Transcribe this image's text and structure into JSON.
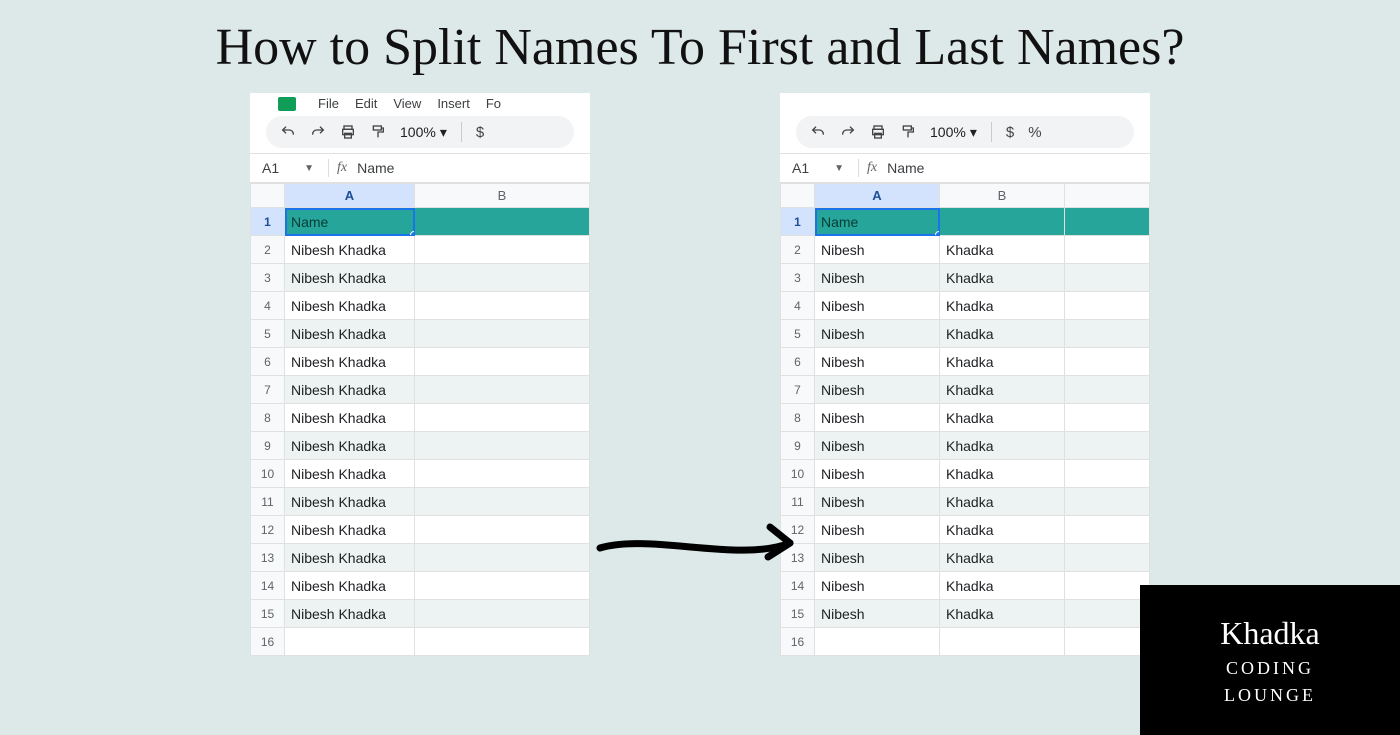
{
  "title": "How to Split Names To First and Last Names?",
  "toolbar": {
    "zoom": "100%",
    "currency": "$",
    "percent": "%"
  },
  "menubar": [
    "File",
    "Edit",
    "View",
    "Insert",
    "Fo"
  ],
  "formula_bar": {
    "cell_ref": "A1",
    "fx_label": "fx",
    "value": "Name"
  },
  "columns": [
    "A",
    "B"
  ],
  "left_sheet": {
    "header_row": {
      "A": "Name",
      "B": ""
    },
    "rows": [
      {
        "n": 2,
        "A": "Nibesh  Khadka",
        "B": ""
      },
      {
        "n": 3,
        "A": "Nibesh Khadka",
        "B": ""
      },
      {
        "n": 4,
        "A": "Nibesh Khadka",
        "B": ""
      },
      {
        "n": 5,
        "A": "Nibesh Khadka",
        "B": ""
      },
      {
        "n": 6,
        "A": "Nibesh Khadka",
        "B": ""
      },
      {
        "n": 7,
        "A": "Nibesh Khadka",
        "B": ""
      },
      {
        "n": 8,
        "A": "Nibesh Khadka",
        "B": ""
      },
      {
        "n": 9,
        "A": "Nibesh Khadka",
        "B": ""
      },
      {
        "n": 10,
        "A": "Nibesh Khadka",
        "B": ""
      },
      {
        "n": 11,
        "A": "Nibesh Khadka",
        "B": ""
      },
      {
        "n": 12,
        "A": "Nibesh Khadka",
        "B": ""
      },
      {
        "n": 13,
        "A": "Nibesh Khadka",
        "B": ""
      },
      {
        "n": 14,
        "A": "Nibesh Khadka",
        "B": ""
      },
      {
        "n": 15,
        "A": "Nibesh Khadka",
        "B": ""
      },
      {
        "n": 16,
        "A": "",
        "B": ""
      }
    ]
  },
  "right_sheet": {
    "header_row": {
      "A": "Name",
      "B": ""
    },
    "rows": [
      {
        "n": 2,
        "A": "Nibesh",
        "B": "Khadka"
      },
      {
        "n": 3,
        "A": "Nibesh",
        "B": "Khadka"
      },
      {
        "n": 4,
        "A": "Nibesh",
        "B": "Khadka"
      },
      {
        "n": 5,
        "A": "Nibesh",
        "B": "Khadka"
      },
      {
        "n": 6,
        "A": "Nibesh",
        "B": "Khadka"
      },
      {
        "n": 7,
        "A": "Nibesh",
        "B": "Khadka"
      },
      {
        "n": 8,
        "A": "Nibesh",
        "B": "Khadka"
      },
      {
        "n": 9,
        "A": "Nibesh",
        "B": "Khadka"
      },
      {
        "n": 10,
        "A": "Nibesh",
        "B": "Khadka"
      },
      {
        "n": 11,
        "A": "Nibesh",
        "B": "Khadka"
      },
      {
        "n": 12,
        "A": "Nibesh",
        "B": "Khadka"
      },
      {
        "n": 13,
        "A": "Nibesh",
        "B": "Khadka"
      },
      {
        "n": 14,
        "A": "Nibesh",
        "B": "Khadka"
      },
      {
        "n": 15,
        "A": "Nibesh",
        "B": "Khadka"
      },
      {
        "n": 16,
        "A": "",
        "B": ""
      }
    ]
  },
  "badge": {
    "script": "Khadka",
    "line1": "CODING",
    "line2": "LOUNGE"
  }
}
